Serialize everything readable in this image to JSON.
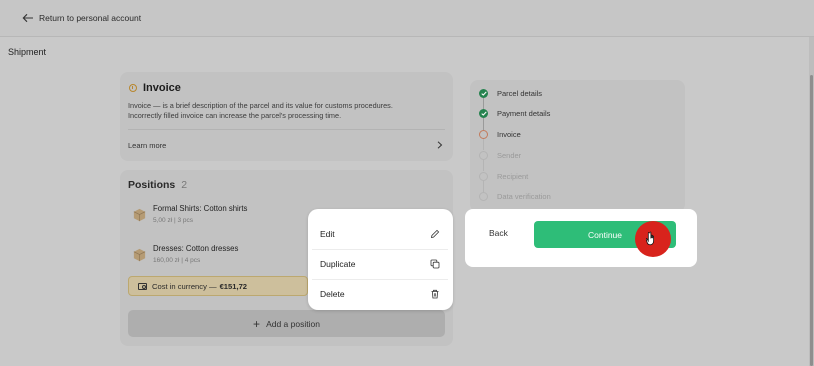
{
  "topbar": {
    "back_label": "Return to personal account"
  },
  "page": {
    "section_title": "Shipment"
  },
  "invoice": {
    "title": "Invoice",
    "description_line1": "Invoice — is a brief description of the parcel and its value for customs procedures.",
    "description_line2": "Incorrectly filled invoice can increase the parcel's processing time.",
    "learn_more": "Learn more"
  },
  "positions": {
    "title": "Positions",
    "count": "2",
    "items": [
      {
        "name": "Formal Shirts: Cotton shirts",
        "price": "5,00 zł",
        "qty": "3 pcs"
      },
      {
        "name": "Dresses: Cotton dresses",
        "price": "160,00 zł",
        "qty": "4 pcs"
      }
    ],
    "currency_label": "Cost in currency —",
    "currency_value": "€151,72",
    "add_label": "Add a position"
  },
  "steps": [
    {
      "label": "Parcel details",
      "state": "done"
    },
    {
      "label": "Payment details",
      "state": "done"
    },
    {
      "label": "Invoice",
      "state": "current"
    },
    {
      "label": "Sender",
      "state": "todo"
    },
    {
      "label": "Recipient",
      "state": "todo"
    },
    {
      "label": "Data verification",
      "state": "todo"
    }
  ],
  "actions": {
    "back_label": "Back",
    "continue_label": "Continue"
  },
  "context_menu": {
    "items": [
      {
        "label": "Edit",
        "icon": "pencil-icon"
      },
      {
        "label": "Duplicate",
        "icon": "copy-icon"
      },
      {
        "label": "Delete",
        "icon": "trash-icon"
      }
    ]
  },
  "colors": {
    "accent_green": "#2ebd78",
    "done_green": "#26824f",
    "cursor_red": "#d8231c"
  }
}
